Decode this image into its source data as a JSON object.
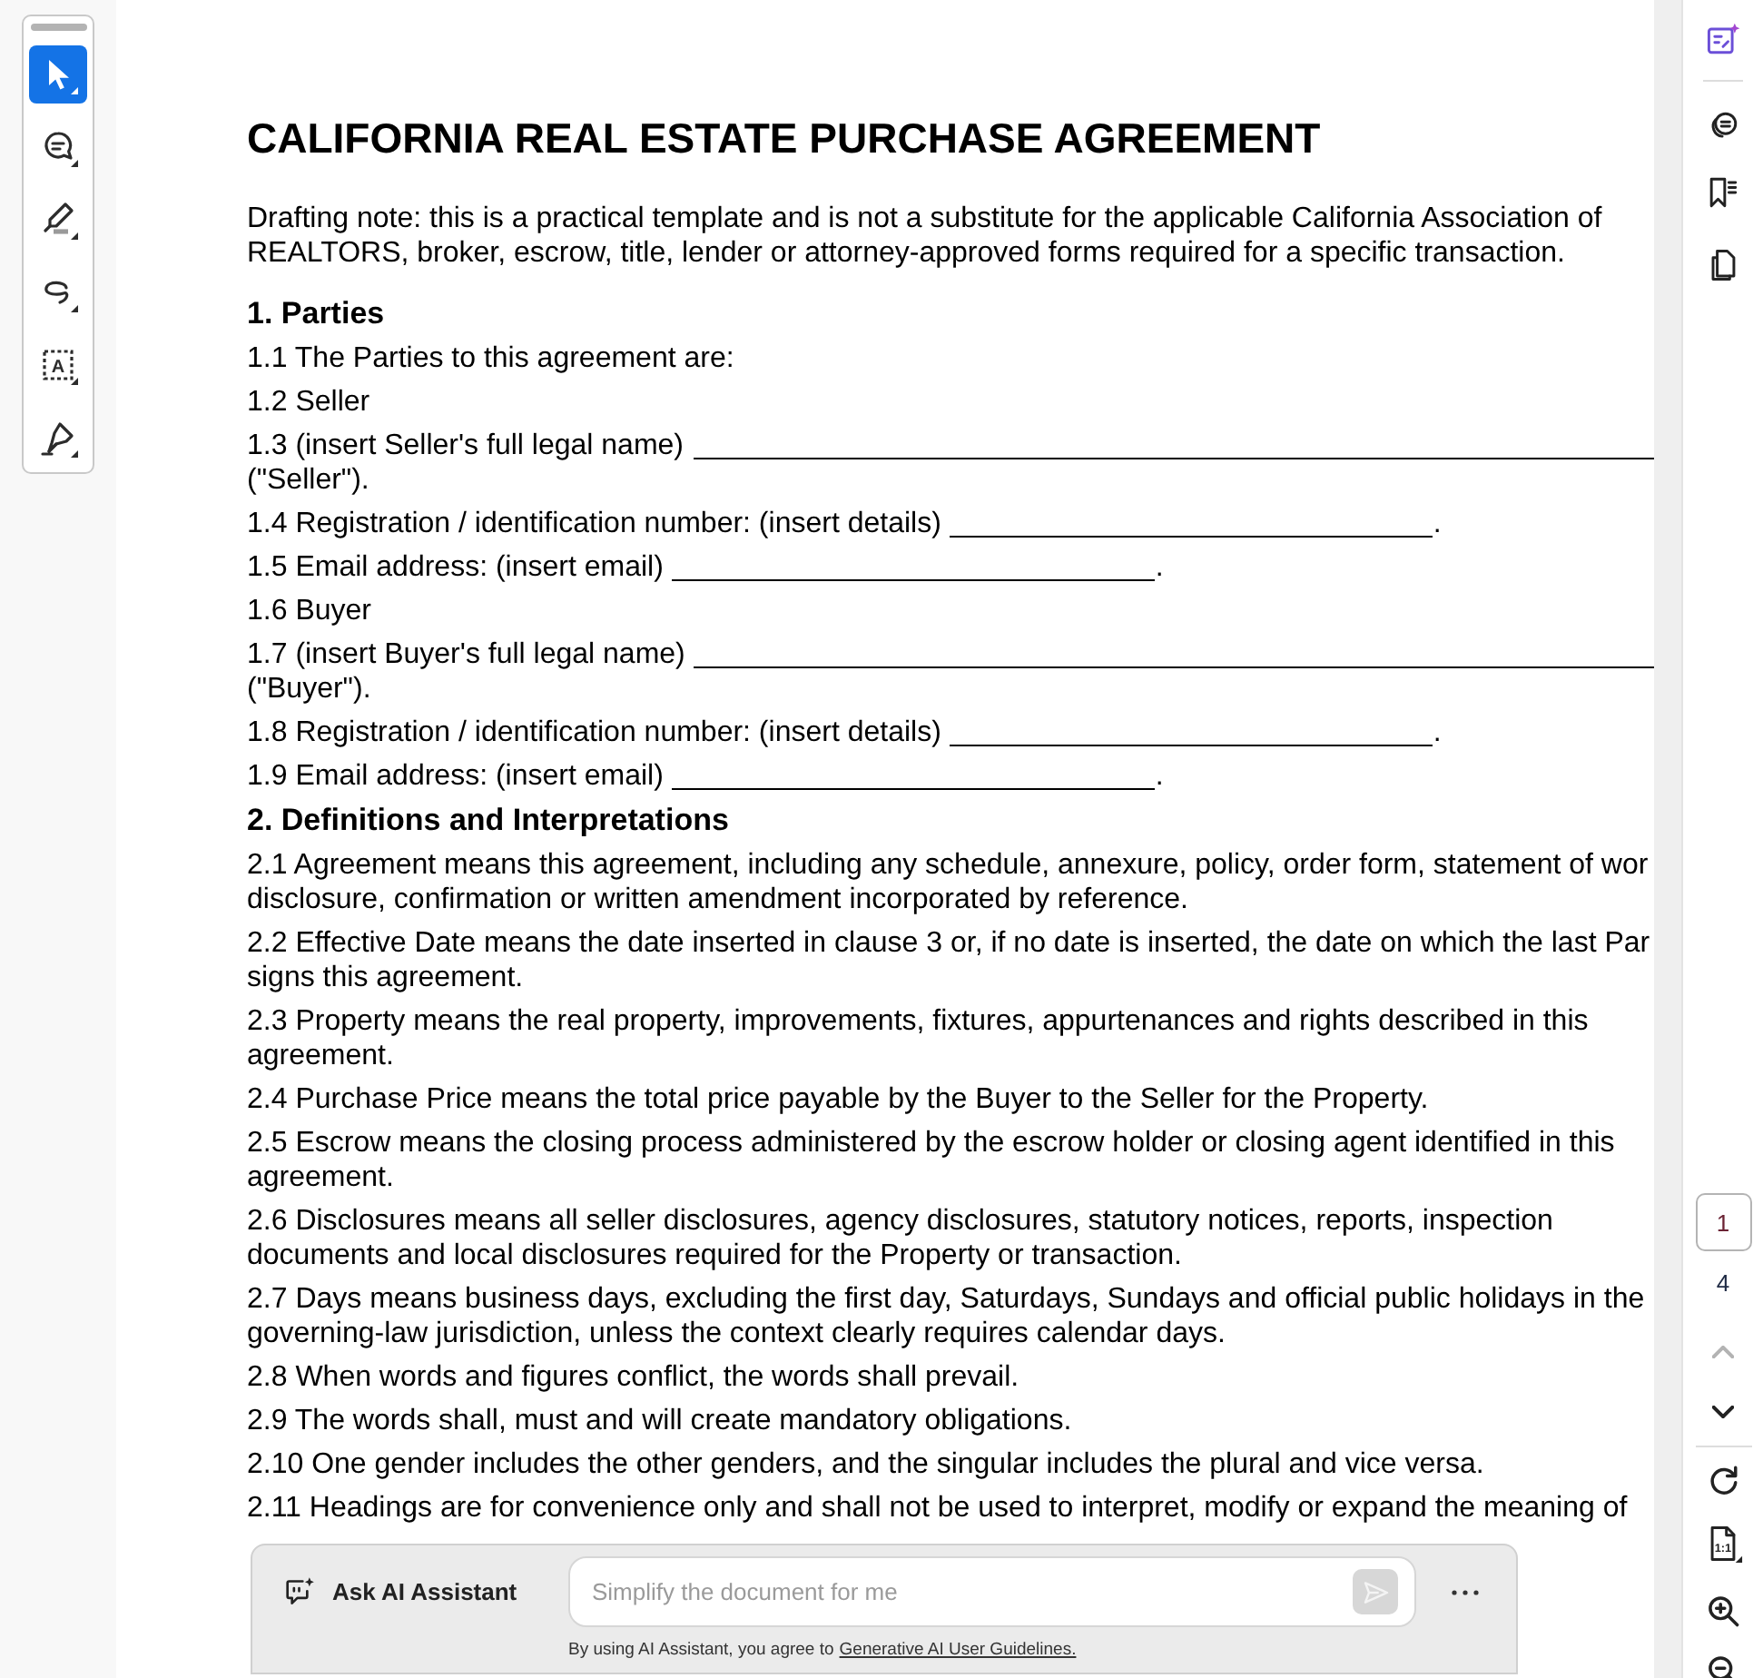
{
  "left_toolbar": {
    "tools": [
      {
        "kind": "select",
        "selected": true
      },
      {
        "kind": "comment",
        "selected": false
      },
      {
        "kind": "highlight",
        "selected": false
      },
      {
        "kind": "draw",
        "selected": false
      },
      {
        "kind": "text_box",
        "glyph": "A",
        "selected": false
      },
      {
        "kind": "sign",
        "selected": false
      }
    ]
  },
  "document": {
    "title": "CALIFORNIA REAL ESTATE PURCHASE AGREEMENT",
    "note": [
      "Drafting note: this is a practical template and is not a substitute for the applicable California Association of",
      "REALTORS, broker, escrow, title, lender or attorney-approved forms required for a specific transaction."
    ],
    "sections": [
      {
        "heading": "1. Parties",
        "clauses": [
          {
            "kind": "text",
            "lines": [
              "1.1 The Parties to this agreement are:"
            ]
          },
          {
            "kind": "text",
            "lines": [
              "1.2 Seller"
            ]
          },
          {
            "kind": "blank_line",
            "label": "1.3 (insert Seller's full legal name)",
            "after": "(\"Seller\")."
          },
          {
            "kind": "blank_inline",
            "label": "1.4 Registration / identification number: (insert details)",
            "after": "."
          },
          {
            "kind": "blank_inline",
            "label": "1.5 Email address: (insert email)",
            "after": "."
          },
          {
            "kind": "text",
            "lines": [
              "1.6 Buyer"
            ]
          },
          {
            "kind": "blank_line",
            "label": "1.7 (insert Buyer's full legal name)",
            "after": "(\"Buyer\")."
          },
          {
            "kind": "blank_inline",
            "label": "1.8 Registration / identification number: (insert details)",
            "after": "."
          },
          {
            "kind": "blank_inline",
            "label": "1.9 Email address: (insert email)",
            "after": "."
          }
        ]
      },
      {
        "heading": "2. Definitions and Interpretations",
        "clauses": [
          {
            "kind": "text",
            "lines": [
              "2.1 Agreement means this agreement, including any schedule, annexure, policy, order form, statement of wor",
              "disclosure, confirmation or written amendment incorporated by reference."
            ]
          },
          {
            "kind": "text",
            "lines": [
              "2.2 Effective Date means the date inserted in clause 3 or, if no date is inserted, the date on which the last Par",
              "signs this agreement."
            ]
          },
          {
            "kind": "text",
            "lines": [
              "2.3 Property means the real property, improvements, fixtures, appurtenances and rights described in this",
              "agreement."
            ]
          },
          {
            "kind": "text",
            "lines": [
              "2.4 Purchase Price means the total price payable by the Buyer to the Seller for the Property."
            ]
          },
          {
            "kind": "text",
            "lines": [
              "2.5 Escrow means the closing process administered by the escrow holder or closing agent identified in this",
              "agreement."
            ]
          },
          {
            "kind": "text",
            "lines": [
              "2.6 Disclosures means all seller disclosures, agency disclosures, statutory notices, reports, inspection",
              "documents and local disclosures required for the Property or transaction."
            ]
          },
          {
            "kind": "text",
            "lines": [
              "2.7 Days means business days, excluding the first day, Saturdays, Sundays and official public holidays in the",
              "governing-law jurisdiction, unless the context clearly requires calendar days."
            ]
          },
          {
            "kind": "text",
            "lines": [
              "2.8 When words and figures conflict, the words shall prevail."
            ]
          },
          {
            "kind": "text",
            "lines": [
              "2.9 The words shall, must and will create mandatory obligations."
            ]
          },
          {
            "kind": "text",
            "lines": [
              "2.10 One gender includes the other genders, and the singular includes the plural and vice versa."
            ]
          },
          {
            "kind": "text",
            "lines": [
              "2.11 Headings are for convenience only and shall not be used to interpret, modify or expand the meaning of"
            ]
          }
        ]
      }
    ]
  },
  "page_nav": {
    "page": "1",
    "total": "4",
    "previous_disabled": true,
    "next_disabled": false
  },
  "view_tools": {
    "actual_size_glyph": "1:1"
  },
  "ai_assistant": {
    "title": "Ask AI Assistant",
    "placeholder": "Simplify the document for me",
    "send_disabled": true,
    "disclaimer": "By using AI Assistant, you agree to",
    "link": "Generative AI User Guidelines."
  }
}
